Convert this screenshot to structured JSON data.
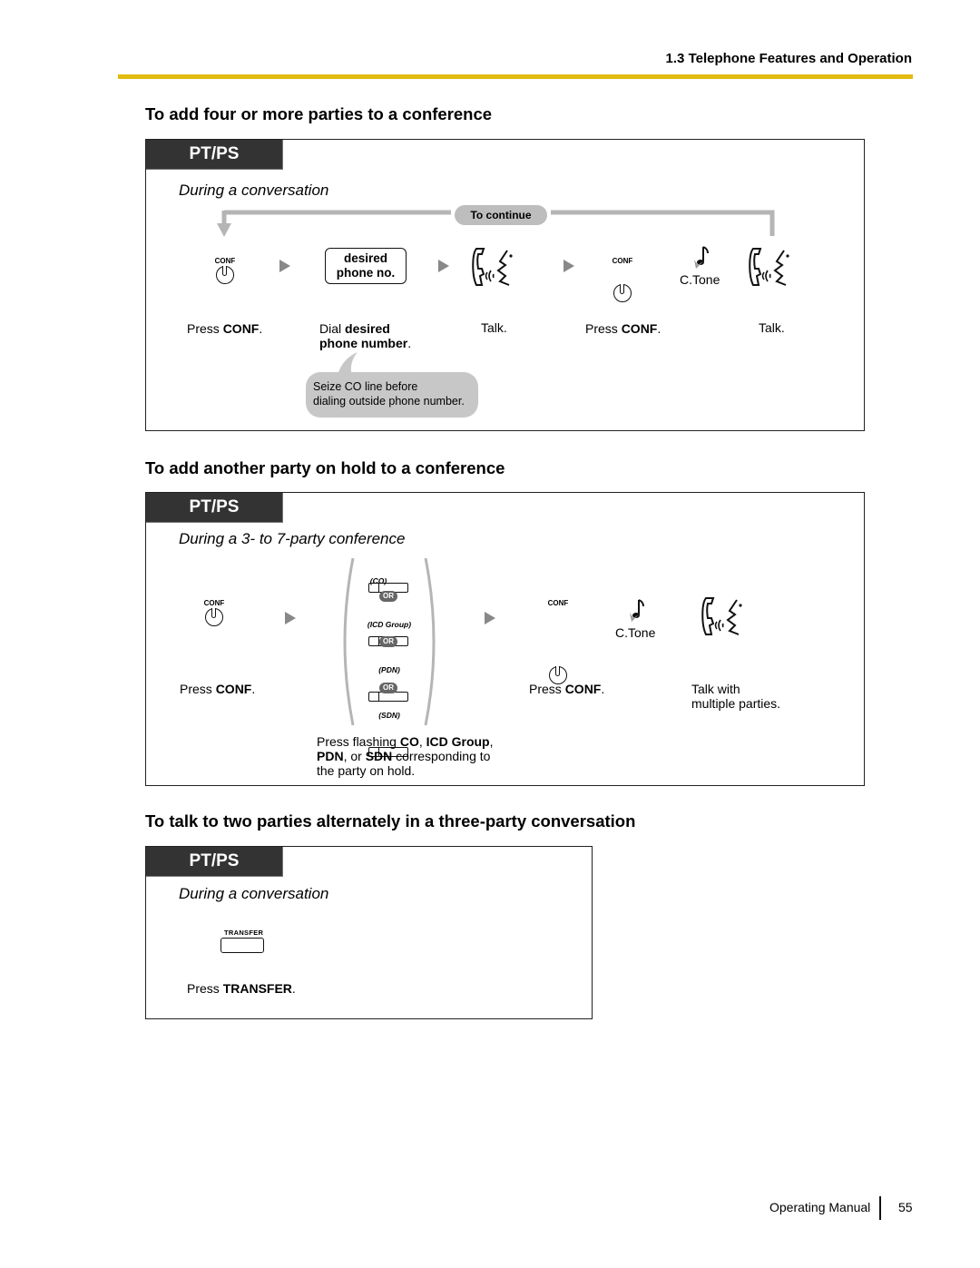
{
  "header": {
    "section": "1.3 Telephone Features and Operation"
  },
  "sections": [
    {
      "title": "To add four or more parties to a conference",
      "tag": "PT/PS",
      "context": "During a conversation",
      "loop_label": "To continue",
      "dial_box": [
        "desired",
        "phone no."
      ],
      "conf_key": "CONF",
      "ctone": "C.Tone",
      "steps": [
        {
          "prefix": "Press ",
          "bold": "CONF",
          "suffix": "."
        },
        {
          "prefix": "Dial ",
          "bold": "desired",
          "bold2": "phone number",
          "suffix": "."
        },
        {
          "text": "Talk."
        },
        {
          "prefix": "Press ",
          "bold": "CONF",
          "suffix": "."
        },
        {
          "text": "Talk."
        }
      ],
      "note": [
        "Seize CO line before",
        "dialing outside phone number."
      ]
    },
    {
      "title": "To add another party on hold to a conference",
      "tag": "PT/PS",
      "context": "During a 3- to 7-party conference",
      "conf_key": "CONF",
      "ctone": "C.Tone",
      "keys": [
        "(CO)",
        "(ICD Group)",
        "(PDN)",
        "(SDN)"
      ],
      "or_label": "OR",
      "steps": [
        {
          "prefix": "Press ",
          "bold": "CONF",
          "suffix": "."
        },
        {
          "line1_prefix": "Press flashing ",
          "co": "CO",
          "sep1": ", ",
          "icd": "ICD Group",
          "sep2": ",",
          "pdn": "PDN",
          "sep3": ", or ",
          "sdn": "SDN",
          "line2_suffix": " corresponding to",
          "line3": "the party on hold."
        },
        {
          "prefix": "Press ",
          "bold": "CONF",
          "suffix": "."
        },
        {
          "line1": "Talk with",
          "line2": "multiple parties."
        }
      ]
    },
    {
      "title": "To talk to two parties alternately in a three-party conversation",
      "tag": "PT/PS",
      "context": "During a conversation",
      "key": "TRANSFER",
      "steps": [
        {
          "prefix": "Press ",
          "bold": "TRANSFER",
          "suffix": "."
        }
      ]
    }
  ],
  "footer": {
    "manual": "Operating Manual",
    "page": "55"
  }
}
